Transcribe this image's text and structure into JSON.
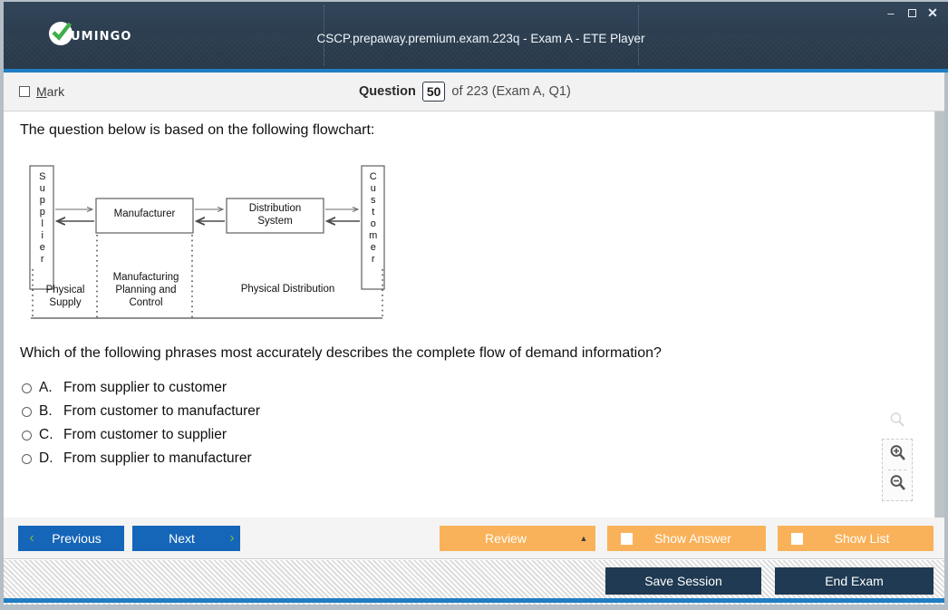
{
  "window": {
    "logo_text": "UMINGO",
    "logo_icon": "check-circle-icon",
    "title": "CSCP.prepaway.premium.exam.223q - Exam A - ETE Player",
    "controls": {
      "minimize": "–",
      "maximize": "maximize-icon",
      "close": "✕"
    }
  },
  "question_bar": {
    "mark_accel": "M",
    "mark_rest": "ark",
    "question_label": "Question",
    "question_number": "50",
    "of_text": "of 223 (Exam A, Q1)"
  },
  "content": {
    "intro": "The question below is based on the following flowchart:",
    "prompt": "Which of the following phrases most accurately describes the complete flow of demand information?",
    "options": [
      {
        "letter": "A.",
        "text": "From supplier to customer"
      },
      {
        "letter": "B.",
        "text": "From customer to manufacturer"
      },
      {
        "letter": "C.",
        "text": "From customer to supplier"
      },
      {
        "letter": "D.",
        "text": "From supplier to manufacturer"
      }
    ]
  },
  "flowchart": {
    "nodes": {
      "supplier": "Supplier",
      "manufacturer": "Manufacturer",
      "distribution_line1": "Distribution",
      "distribution_line2": "System",
      "customer": "Customer"
    },
    "zone_labels": {
      "physical_supply_line1": "Physical",
      "physical_supply_line2": "Supply",
      "mpc_line1": "Manufacturing",
      "mpc_line2": "Planning and",
      "mpc_line3": "Control",
      "physical_distribution": "Physical Distribution"
    }
  },
  "zoom_tools": {
    "plain": "magnifier-icon",
    "zoom_in": "zoom-in-icon",
    "zoom_out": "zoom-out-icon"
  },
  "toolbar": {
    "previous_label": "Previous",
    "next_label": "Next",
    "review_label": "Review",
    "review_caret": "▲",
    "show_answer_label": "Show Answer",
    "show_list_label": "Show List",
    "prev_chevron": "‹",
    "next_chevron": "›"
  },
  "footer": {
    "save_session_label": "Save Session",
    "end_exam_label": "End Exam"
  },
  "colors": {
    "titlebar": "#2c3e50",
    "accent_blue": "#1f7dc4",
    "button_blue": "#1565b8",
    "button_orange": "#f9b25a",
    "button_dark": "#1f3a52",
    "chevron_green": "#7ab648"
  }
}
